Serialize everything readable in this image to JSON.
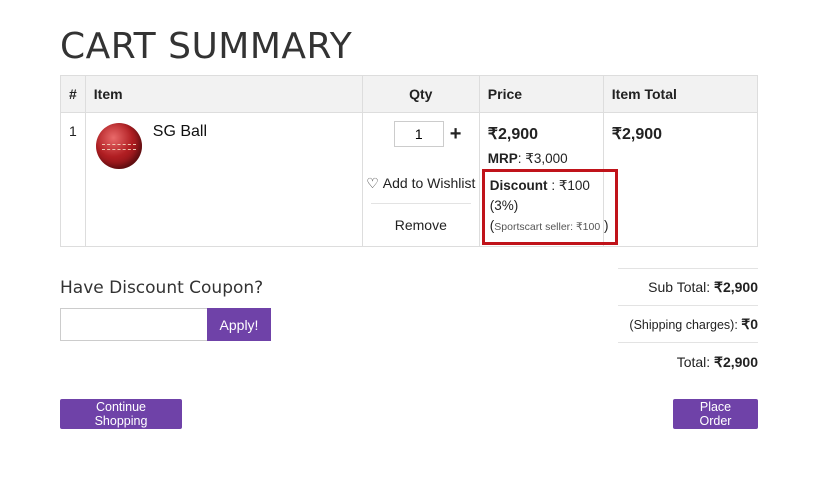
{
  "page": {
    "title": "CART SUMMARY"
  },
  "table": {
    "headers": {
      "num": "#",
      "item": "Item",
      "qty": "Qty",
      "price": "Price",
      "total": "Item Total"
    },
    "rows": [
      {
        "num": "1",
        "item_name": "SG Ball",
        "qty": "1",
        "qty_plus": "+",
        "wishlist_label": "Add to Wishlist",
        "remove_label": "Remove",
        "price": "₹2,900",
        "mrp_label": "MRP",
        "mrp_value": ": ₹3,000",
        "discount_label": "Discount",
        "discount_value": " : ₹100",
        "discount_pct": "(3%)",
        "seller_open": "(",
        "seller_text": "Sportscart seller: ₹100",
        "seller_close": ")",
        "item_total": "₹2,900"
      }
    ]
  },
  "coupon": {
    "title": "Have Discount Coupon?",
    "input_value": "",
    "apply_label": "Apply!"
  },
  "summary": {
    "subtotal_label": "Sub Total: ",
    "subtotal_value": "₹2,900",
    "shipping_label": "(Shipping charges): ",
    "shipping_value": "₹0",
    "total_label": "Total: ",
    "total_value": "₹2,900"
  },
  "actions": {
    "continue_label": "Continue Shopping",
    "place_order_label": "Place Order"
  },
  "colors": {
    "accent": "#6f42a8",
    "highlight_border": "#c0131a"
  }
}
